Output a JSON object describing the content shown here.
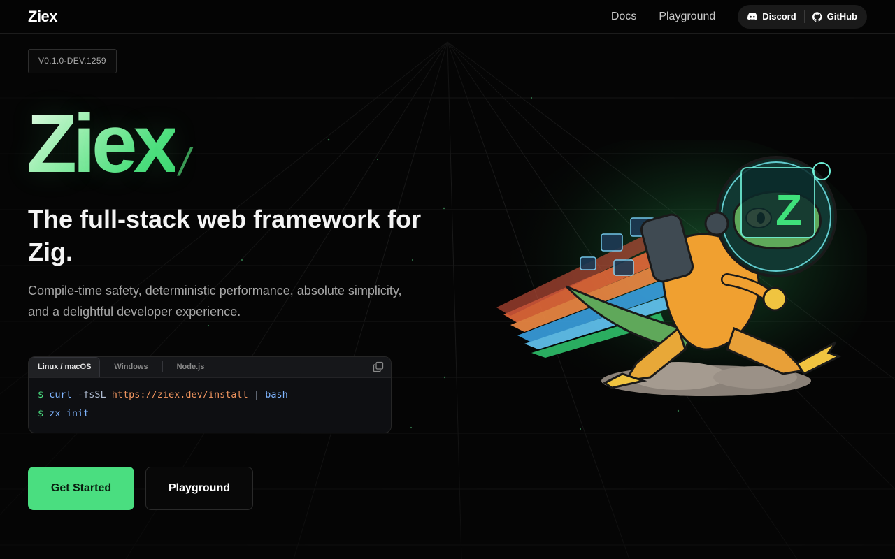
{
  "nav": {
    "brand": "Ziex",
    "links": [
      {
        "label": "Docs"
      },
      {
        "label": "Playground"
      }
    ],
    "social": {
      "discord_label": "Discord",
      "github_label": "GitHub"
    }
  },
  "hero": {
    "version": "V0.1.0-DEV.1259",
    "logo_text": "Ziex",
    "logo_slash": "/",
    "headline": "The full-stack web framework for Zig.",
    "subhead": "Compile-time safety, deterministic performance, absolute simplicity, and a delightful developer experience."
  },
  "install": {
    "tabs": [
      {
        "label": "Linux / macOS",
        "active": true
      },
      {
        "label": "Windows",
        "active": false
      },
      {
        "label": "Node.js",
        "active": false
      }
    ],
    "lines": [
      {
        "prompt": "$",
        "cmd": "curl",
        "flag": "-fsSL",
        "url": "https://ziex.dev/install",
        "pipe": "|",
        "target": "bash"
      },
      {
        "prompt": "$",
        "cmd": "zx",
        "arg": "init"
      }
    ]
  },
  "actions": {
    "primary": "Get Started",
    "secondary": "Playground"
  },
  "colors": {
    "accent": "#4ade80",
    "background": "#050505"
  },
  "icons": [
    "discord-icon",
    "github-icon",
    "copy-icon"
  ]
}
